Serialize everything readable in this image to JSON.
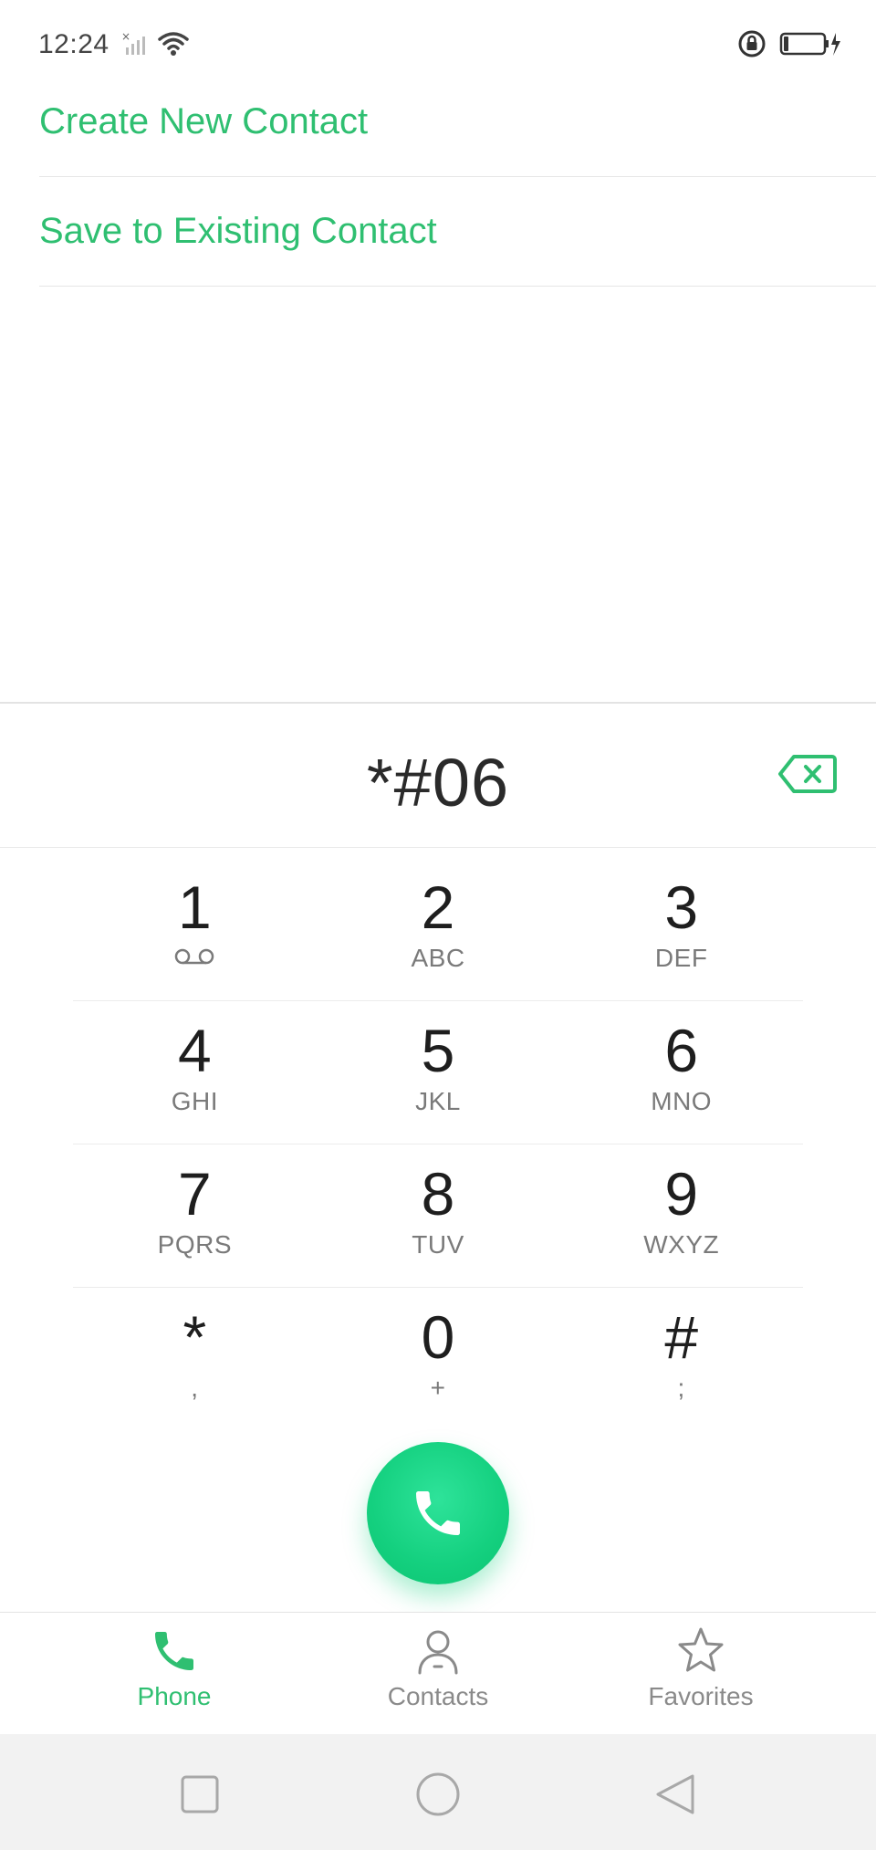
{
  "status_bar": {
    "time": "12:24",
    "icons": [
      "no-sim-signal-icon",
      "wifi-icon",
      "rotation-lock-icon",
      "battery-charging-icon"
    ]
  },
  "options": {
    "create_new": "Create New Contact",
    "save_existing": "Save to Existing Contact"
  },
  "dialer": {
    "number": "*#06",
    "keys": [
      [
        {
          "digit": "1",
          "sub": "",
          "sub_icon": "voicemail-icon"
        },
        {
          "digit": "2",
          "sub": "ABC"
        },
        {
          "digit": "3",
          "sub": "DEF"
        }
      ],
      [
        {
          "digit": "4",
          "sub": "GHI"
        },
        {
          "digit": "5",
          "sub": "JKL"
        },
        {
          "digit": "6",
          "sub": "MNO"
        }
      ],
      [
        {
          "digit": "7",
          "sub": "PQRS"
        },
        {
          "digit": "8",
          "sub": "TUV"
        },
        {
          "digit": "9",
          "sub": "WXYZ"
        }
      ],
      [
        {
          "digit": "*",
          "sub": ","
        },
        {
          "digit": "0",
          "sub": "+"
        },
        {
          "digit": "#",
          "sub": ";"
        }
      ]
    ]
  },
  "tabs": {
    "phone": "Phone",
    "contacts": "Contacts",
    "favorites": "Favorites",
    "active": "Phone"
  },
  "colors": {
    "accent": "#2fbf71",
    "call_button": "#14d07f",
    "inactive": "#8a8a8a"
  }
}
